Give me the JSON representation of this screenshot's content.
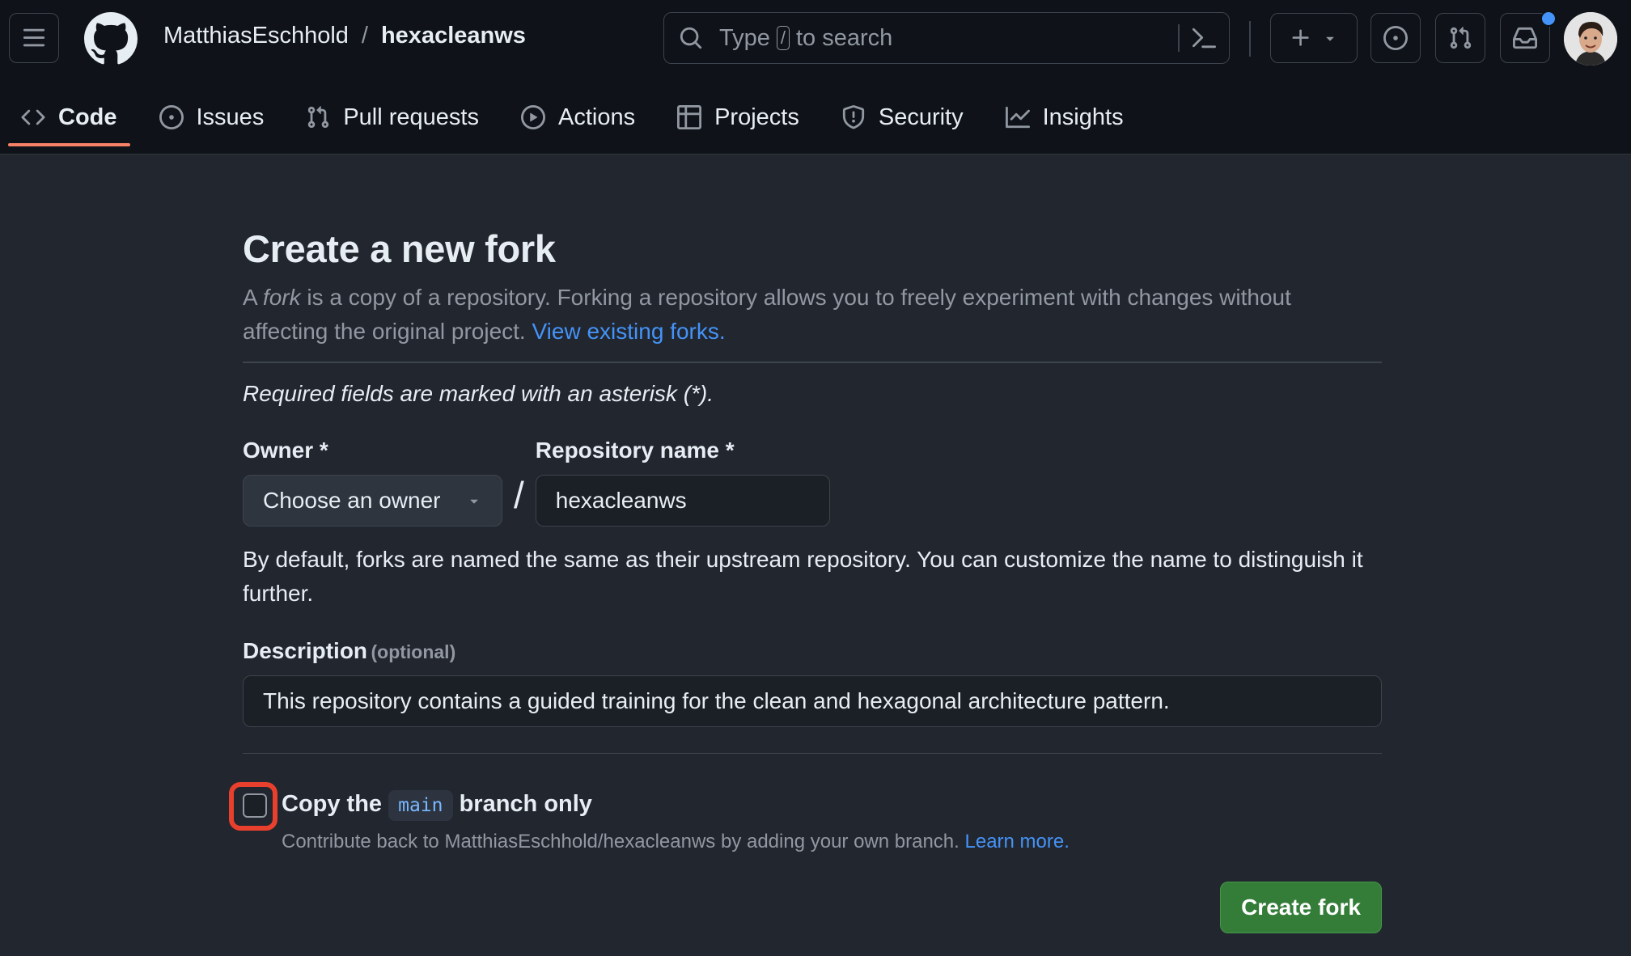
{
  "header": {
    "breadcrumb_owner": "MatthiasEschhold",
    "breadcrumb_sep": "/",
    "breadcrumb_repo": "hexacleanws",
    "search_prefix": "Type",
    "search_key": "/",
    "search_suffix": "to search"
  },
  "tabs": [
    {
      "label": "Code",
      "icon": "code-icon",
      "active": true
    },
    {
      "label": "Issues",
      "icon": "issue-opened-icon"
    },
    {
      "label": "Pull requests",
      "icon": "git-pull-request-icon"
    },
    {
      "label": "Actions",
      "icon": "play-icon"
    },
    {
      "label": "Projects",
      "icon": "table-icon"
    },
    {
      "label": "Security",
      "icon": "shield-icon"
    },
    {
      "label": "Insights",
      "icon": "graph-icon"
    }
  ],
  "fork": {
    "title": "Create a new fork",
    "intro_a": "A ",
    "intro_fork": "fork",
    "intro_b": " is a copy of a repository. Forking a repository allows you to freely experiment with changes without affecting the original project. ",
    "view_forks_link": "View existing forks.",
    "required_note": "Required fields are marked with an asterisk (*).",
    "owner_label": "Owner *",
    "owner_select": "Choose an owner",
    "slash": "/",
    "repo_label": "Repository name *",
    "repo_value": "hexacleanws",
    "repo_help": "By default, forks are named the same as their upstream repository. You can customize the name to distinguish it further.",
    "desc_label": "Description",
    "desc_optional": "(optional)",
    "desc_value": "This repository contains a guided training for the clean and hexagonal architecture pattern.",
    "copy_a": "Copy the ",
    "copy_branch": "main",
    "copy_b": " branch only",
    "copy_checked": false,
    "copy_help": "Contribute back to MatthiasEschhold/hexacleanws by adding your own branch. ",
    "learn_more": "Learn more.",
    "create_button": "Create fork"
  },
  "colors": {
    "accent_link": "#4493f8",
    "primary_button": "#347d39",
    "active_tab_underline": "#f78166",
    "highlight_ring": "#e8402d"
  }
}
